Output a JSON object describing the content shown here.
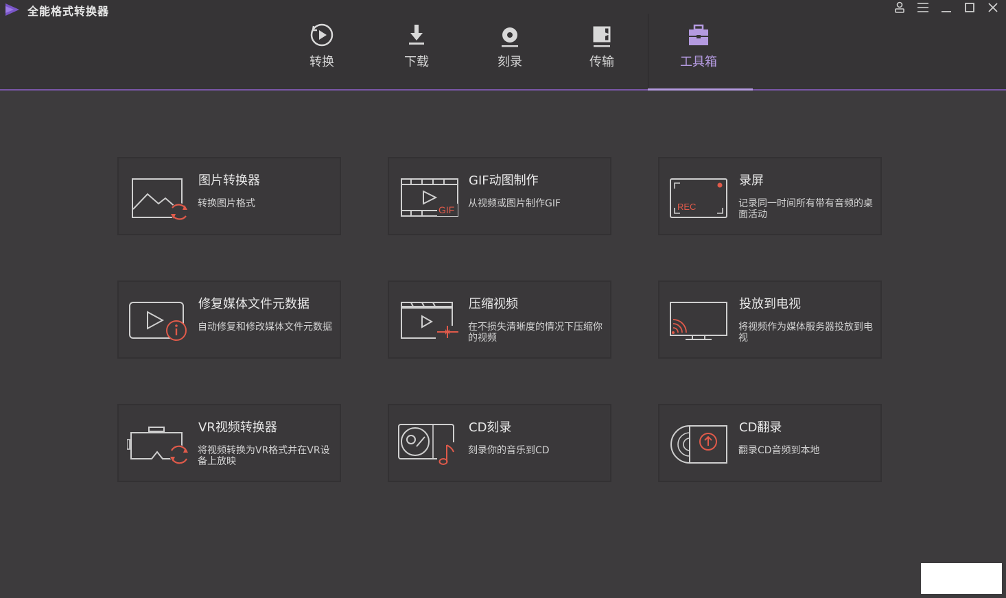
{
  "app": {
    "title": "全能格式转换器"
  },
  "nav": {
    "tabs": [
      {
        "label": "转换",
        "icon": "convert-play-icon",
        "active": false
      },
      {
        "label": "下载",
        "icon": "download-icon",
        "active": false
      },
      {
        "label": "刻录",
        "icon": "burn-disc-icon",
        "active": false
      },
      {
        "label": "传输",
        "icon": "transfer-icon",
        "active": false
      },
      {
        "label": "工具箱",
        "icon": "toolbox-icon",
        "active": true
      }
    ]
  },
  "colors": {
    "accent": "#b49ae0",
    "tool_icon_red": "#e05a4a",
    "background": "#3d3b3d"
  },
  "tools": [
    {
      "title": "图片转换器",
      "desc": "转换图片格式",
      "icon": "image-convert-icon"
    },
    {
      "title": "GIF动图制作",
      "desc": "从视频或图片制作GIF",
      "icon": "gif-maker-icon",
      "icon_text": "GIF"
    },
    {
      "title": "录屏",
      "desc": "记录同一时间所有带有音频的桌面活动",
      "icon": "screen-record-icon",
      "icon_text": "REC"
    },
    {
      "title": "修复媒体文件元数据",
      "desc": "自动修复和修改媒体文件元数据",
      "icon": "metadata-fix-icon"
    },
    {
      "title": "压缩视频",
      "desc": "在不损失清晰度的情况下压缩你的视频",
      "icon": "compress-video-icon"
    },
    {
      "title": "投放到电视",
      "desc": "将视频作为媒体服务器投放到电视",
      "icon": "cast-tv-icon"
    },
    {
      "title": "VR视频转换器",
      "desc": "将视频转换为VR格式并在VR设备上放映",
      "icon": "vr-convert-icon"
    },
    {
      "title": "CD刻录",
      "desc": "刻录你的音乐到CD",
      "icon": "cd-burn-icon"
    },
    {
      "title": "CD翻录",
      "desc": "翻录CD音频到本地",
      "icon": "cd-rip-icon"
    }
  ]
}
